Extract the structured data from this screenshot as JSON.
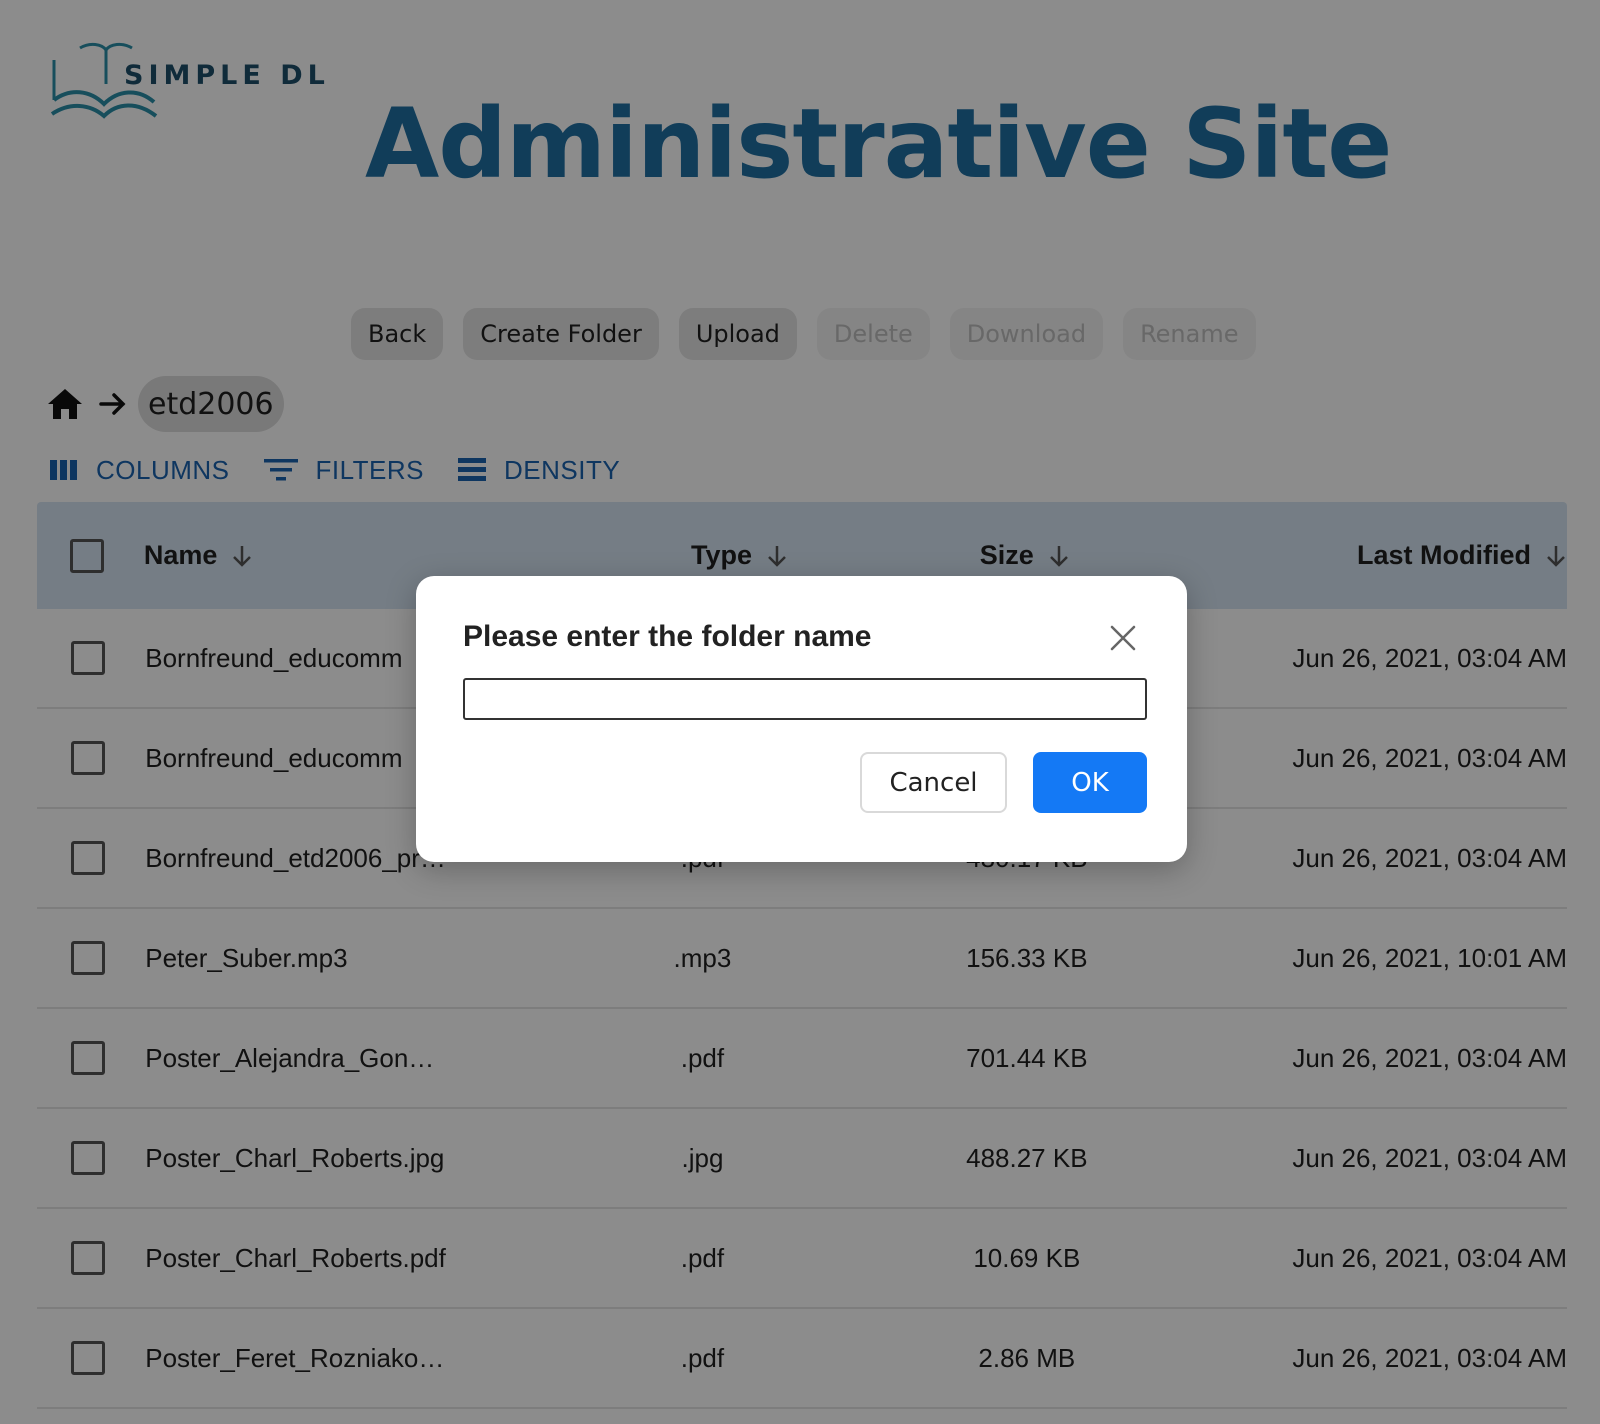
{
  "header": {
    "logo_text": "SIMPLE DL",
    "title": "Administrative Site"
  },
  "toolbar": {
    "back_label": "Back",
    "create_folder_label": "Create Folder",
    "upload_label": "Upload",
    "delete_label": "Delete",
    "download_label": "Download",
    "rename_label": "Rename"
  },
  "breadcrumb": {
    "home_icon": "home-icon",
    "separator_icon": "arrow-right-icon",
    "current_folder": "etd2006"
  },
  "grid_toolbar": {
    "columns_label": "COLUMNS",
    "filters_label": "FILTERS",
    "density_label": "DENSITY"
  },
  "table": {
    "columns": [
      "Name",
      "Type",
      "Size",
      "Last Modified"
    ],
    "rows": [
      {
        "name": "Bornfreund_educomm",
        "type": "",
        "size": "",
        "modified": "Jun 26, 2021, 03:04 AM"
      },
      {
        "name": "Bornfreund_educomm",
        "type": "",
        "size": "",
        "modified": "Jun 26, 2021, 03:04 AM"
      },
      {
        "name": "Bornfreund_etd2006_pr…",
        "type": ".pdf",
        "size": "480.17 KB",
        "modified": "Jun 26, 2021, 03:04 AM"
      },
      {
        "name": "Peter_Suber.mp3",
        "type": ".mp3",
        "size": "156.33 KB",
        "modified": "Jun 26, 2021, 10:01 AM"
      },
      {
        "name": "Poster_Alejandra_Gon…",
        "type": ".pdf",
        "size": "701.44 KB",
        "modified": "Jun 26, 2021, 03:04 AM"
      },
      {
        "name": "Poster_Charl_Roberts.jpg",
        "type": ".jpg",
        "size": "488.27 KB",
        "modified": "Jun 26, 2021, 03:04 AM"
      },
      {
        "name": "Poster_Charl_Roberts.pdf",
        "type": ".pdf",
        "size": "10.69 KB",
        "modified": "Jun 26, 2021, 03:04 AM"
      },
      {
        "name": "Poster_Feret_Rozniako…",
        "type": ".pdf",
        "size": "2.86 MB",
        "modified": "Jun 26, 2021, 03:04 AM"
      }
    ]
  },
  "dialog": {
    "title": "Please enter the folder name",
    "input_value": "",
    "cancel_label": "Cancel",
    "ok_label": "OK"
  },
  "colors": {
    "title_blue": "#1f6fa3",
    "grid_toolbar_blue": "#1b63b0",
    "table_header_bg": "#d6e4f2",
    "ok_button": "#1479f5"
  }
}
